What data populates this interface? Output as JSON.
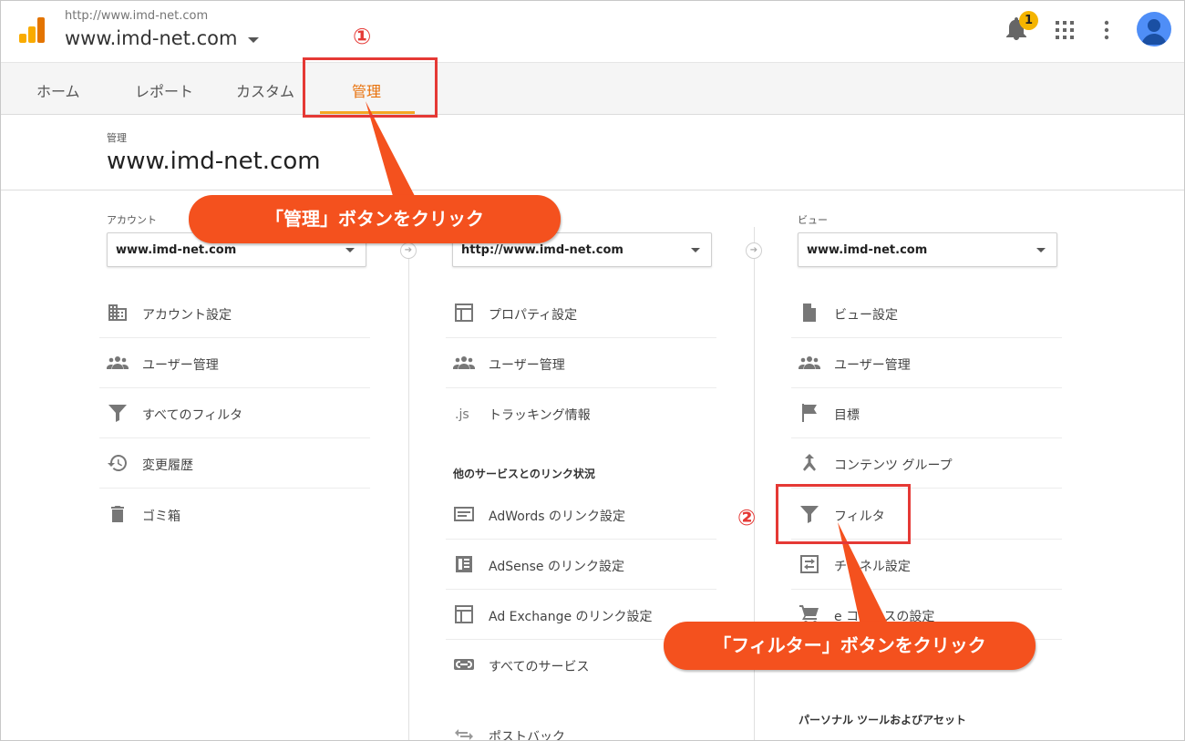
{
  "header": {
    "site_url": "http://www.imd-net.com",
    "site_name": "www.imd-net.com",
    "notification_count": "1"
  },
  "tabs": [
    {
      "label": "ホーム"
    },
    {
      "label": "レポート"
    },
    {
      "label": "カスタム"
    },
    {
      "label": "管理"
    }
  ],
  "page": {
    "crumb": "管理",
    "title": "www.imd-net.com"
  },
  "account": {
    "label": "アカウント",
    "selected": "www.imd-net.com",
    "items": [
      "アカウント設定",
      "ユーザー管理",
      "すべてのフィルタ",
      "変更履歴",
      "ゴミ箱"
    ]
  },
  "property": {
    "selected": "http://www.imd-net.com",
    "items": [
      "プロパティ設定",
      "ユーザー管理",
      "トラッキング情報"
    ],
    "section": "他のサービスとのリンク状況",
    "link_items": [
      "AdWords のリンク設定",
      "AdSense のリンク設定",
      "Ad Exchange のリンク設定",
      "すべてのサービス"
    ],
    "postback": "ポストバック"
  },
  "view": {
    "label": "ビュー",
    "selected": "www.imd-net.com",
    "items": [
      "ビュー設定",
      "ユーザー管理",
      "目標",
      "コンテンツ グループ",
      "フィルタ",
      "チャネル設定",
      "e コマースの設定"
    ],
    "section": "パーソナル ツールおよびアセット"
  },
  "annotations": {
    "num1": "①",
    "num2": "②",
    "bubble1": "「管理」ボタンをクリック",
    "bubble2": "「フィルター」ボタンをクリック"
  },
  "colors": {
    "accent": "#f5a623",
    "annotation": "#e53935",
    "bubble": "#f4511e"
  }
}
